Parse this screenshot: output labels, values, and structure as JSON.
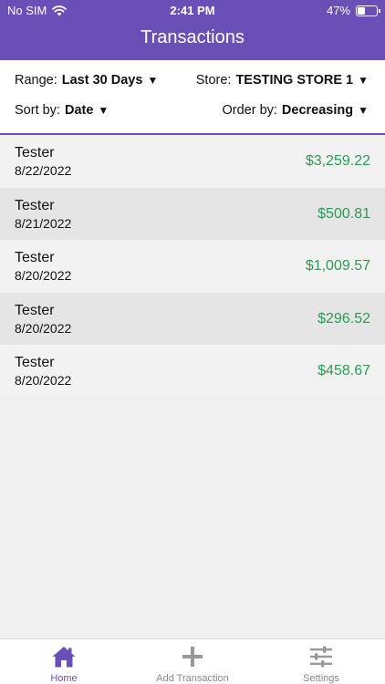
{
  "status": {
    "carrier": "No SIM",
    "time": "2:41 PM",
    "battery": "47%",
    "battery_level": 0.47
  },
  "header": {
    "title": "Transactions"
  },
  "filters": {
    "range_label": "Range:",
    "range_value": "Last 30 Days",
    "store_label": "Store:",
    "store_value": "TESTING STORE 1",
    "sort_label": "Sort by:",
    "sort_value": "Date",
    "order_label": "Order by:",
    "order_value": "Decreasing",
    "caret": "▼"
  },
  "transactions": [
    {
      "name": "Tester",
      "date": "8/22/2022",
      "amount": "$3,259.22"
    },
    {
      "name": "Tester",
      "date": "8/21/2022",
      "amount": "$500.81"
    },
    {
      "name": "Tester",
      "date": "8/20/2022",
      "amount": "$1,009.57"
    },
    {
      "name": "Tester",
      "date": "8/20/2022",
      "amount": "$296.52"
    },
    {
      "name": "Tester",
      "date": "8/20/2022",
      "amount": "$458.67"
    }
  ],
  "tabs": [
    {
      "label": "Home",
      "icon": "home-icon"
    },
    {
      "label": "Add Transaction",
      "icon": "plus-icon"
    },
    {
      "label": "Settings",
      "icon": "sliders-icon"
    }
  ],
  "colors": {
    "brand": "#6a4fb6",
    "amount": "#2e9a55"
  }
}
